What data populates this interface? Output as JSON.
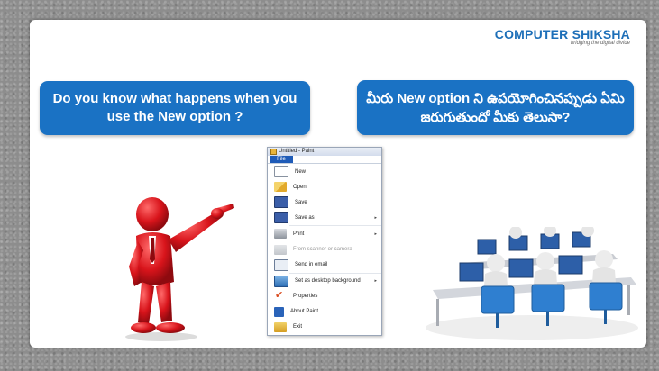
{
  "logo": {
    "name_part1": "COMPUTER",
    "name_part2": " SHIKSHA",
    "tagline": "bridging the digital divide"
  },
  "bubbles": {
    "english": "Do you know what happens when you use the New option ?",
    "telugu": "మీరు New option ని ఉపయోగించినప్పుడు ఏమి జరుగుతుందో మీకు తెలుసా?"
  },
  "menu": {
    "window_title": "Untitled - Paint",
    "tab_label": "File",
    "items": [
      {
        "label": "New",
        "icon": "new-document-icon"
      },
      {
        "label": "Open",
        "icon": "open-folder-icon"
      },
      {
        "label": "Save",
        "icon": "save-disk-icon"
      },
      {
        "label": "Save as",
        "icon": "save-as-icon",
        "submenu": true
      },
      {
        "label": "Print",
        "icon": "printer-icon",
        "submenu": true
      },
      {
        "label": "From scanner or camera",
        "icon": "scanner-icon",
        "disabled": true
      },
      {
        "label": "Send in email",
        "icon": "email-icon"
      },
      {
        "label": "Set as desktop background",
        "icon": "desktop-icon",
        "submenu": true
      },
      {
        "label": "Properties",
        "icon": "properties-check-icon"
      },
      {
        "label": "About Paint",
        "icon": "info-icon"
      },
      {
        "label": "Exit",
        "icon": "exit-icon"
      }
    ],
    "submenu_arrow": "▸"
  },
  "colors": {
    "bubble": "#1a72c4",
    "menu_tab": "#1e5bb8",
    "figure": "#d8141b"
  }
}
